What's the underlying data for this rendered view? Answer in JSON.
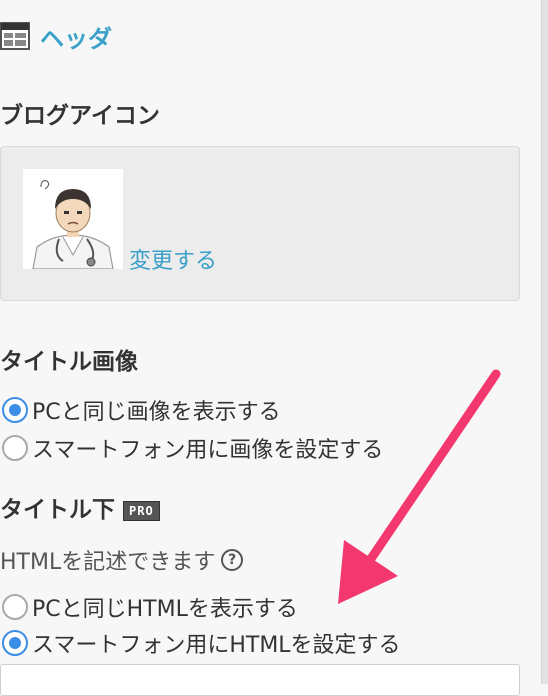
{
  "header_section": {
    "title": "ヘッダ",
    "icon": "layout-icon"
  },
  "blog_icon": {
    "label": "ブログアイコン",
    "change_link": "変更する"
  },
  "title_image": {
    "label": "タイトル画像",
    "options": [
      "PCと同じ画像を表示する",
      "スマートフォン用に画像を設定する"
    ],
    "selected_index": 0
  },
  "title_below": {
    "label": "タイトル下",
    "badge": "PRO",
    "hint": "HTMLを記述できます",
    "options": [
      "PCと同じHTMLを表示する",
      "スマートフォン用にHTMLを設定する"
    ],
    "selected_index": 1
  },
  "colors": {
    "accent": "#3aa0c9",
    "radio": "#3b8ee6",
    "arrow": "#f2386f"
  }
}
